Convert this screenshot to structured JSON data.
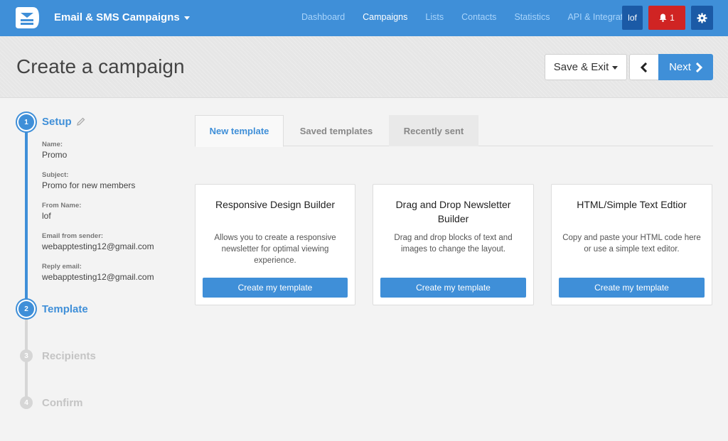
{
  "topbar": {
    "app_title": "Email & SMS Campaigns",
    "nav": [
      "Dashboard",
      "Campaigns",
      "Lists",
      "Contacts",
      "Statistics",
      "API & Integration"
    ],
    "active_nav": "Campaigns",
    "user": "lof",
    "notifications": "1",
    "icons": {
      "logo": "envelope-logo-icon",
      "bell": "bell-icon",
      "settings": "gear-icon"
    }
  },
  "header": {
    "title": "Create a campaign",
    "save_exit_label": "Save & Exit",
    "next_label": "Next"
  },
  "steps": [
    {
      "num": "1",
      "label": "Setup"
    },
    {
      "num": "2",
      "label": "Template"
    },
    {
      "num": "3",
      "label": "Recipients"
    },
    {
      "num": "4",
      "label": "Confirm"
    }
  ],
  "setup_details": [
    {
      "label": "Name:",
      "value": "Promo"
    },
    {
      "label": "Subject:",
      "value": "Promo for new members"
    },
    {
      "label": "From Name:",
      "value": "lof"
    },
    {
      "label": "Email from sender:",
      "value": "webapptesting12@gmail.com"
    },
    {
      "label": "Reply email:",
      "value": "webapptesting12@gmail.com"
    }
  ],
  "tabs": [
    "New template",
    "Saved templates",
    "Recently sent"
  ],
  "cards": [
    {
      "title": "Responsive Design Builder",
      "desc": "Allows you to create a responsive newsletter for optimal viewing experience.",
      "button": "Create my template"
    },
    {
      "title": "Drag and Drop Newsletter Builder",
      "desc": "Drag and drop blocks of text and images to change the layout.",
      "button": "Create my template"
    },
    {
      "title": "HTML/Simple Text Edtior",
      "desc": "Copy and paste your HTML code here or use a simple text editor.",
      "button": "Create my template"
    }
  ],
  "colors": {
    "primary": "#3f8fd8",
    "dark_blue": "#1b5aa6",
    "alert_red": "#d02423"
  }
}
